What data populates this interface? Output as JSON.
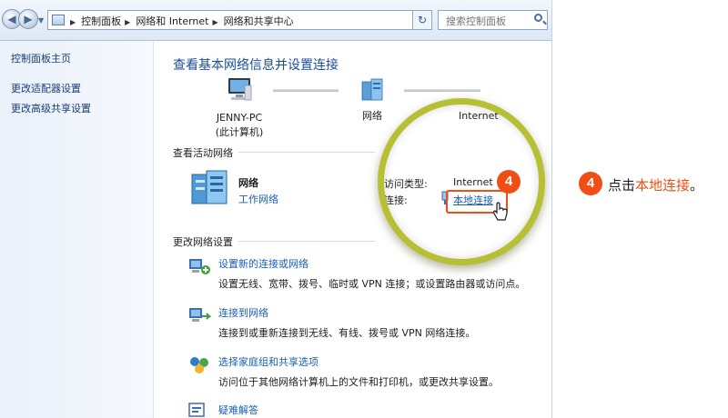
{
  "address_bar": {
    "breadcrumbs": [
      "控制面板",
      "网络和 Internet",
      "网络和共享中心"
    ],
    "search_placeholder": "搜索控制面板"
  },
  "sidebar": {
    "items": [
      {
        "label": "控制面板主页"
      },
      {
        "label": "更改适配器设置"
      },
      {
        "label": "更改高级共享设置"
      }
    ]
  },
  "main": {
    "title": "查看基本网络信息并设置连接",
    "map": {
      "pc_name": "JENNY-PC",
      "pc_sub": "(此计算机)",
      "network": "网络",
      "internet": "Internet"
    },
    "active_section": "查看活动网络",
    "active_network": {
      "name": "网络",
      "type_link": "工作网络",
      "access_label": "访问类型:",
      "access_value": "Internet",
      "connection_label": "连接:",
      "connection_value": "本地连接"
    },
    "change_section": "更改网络设置",
    "tasks": [
      {
        "title": "设置新的连接或网络",
        "desc": "设置无线、宽带、拨号、临时或 VPN 连接；或设置路由器或访问点。"
      },
      {
        "title": "连接到网络",
        "desc": "连接到或重新连接到无线、有线、拨号或 VPN 网络连接。"
      },
      {
        "title": "选择家庭组和共享选项",
        "desc": "访问位于其他网络计算机上的文件和打印机，或更改共享设置。"
      },
      {
        "title": "疑难解答",
        "desc": ""
      }
    ]
  },
  "annotation": {
    "step": "4",
    "instruction_prefix": "点击",
    "instruction_highlight": "本地连接",
    "instruction_suffix": "。",
    "accent_color": "#f04e16"
  }
}
